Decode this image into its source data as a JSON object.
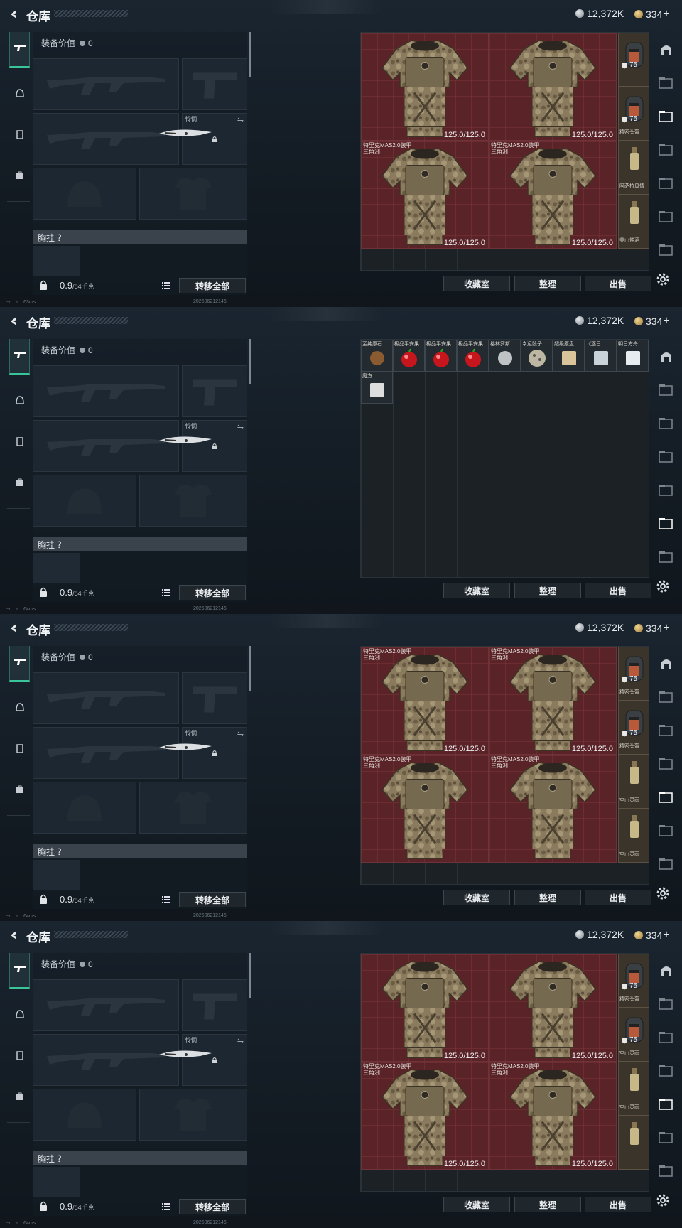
{
  "frames": [
    {
      "title": "仓库",
      "silver": "12,372K",
      "gold": "334",
      "equip_value_label": "装备价值",
      "equip_value": "0",
      "knife_label": "怜悯",
      "chest_label": "胸挂 ？",
      "weight": "0.9",
      "weight_max": "/84千克",
      "transfer_all": "转移全部",
      "btn_vault": "收藏室",
      "btn_sort": "整理",
      "btn_sell": "出售",
      "ping": "63ms",
      "build": "202606212146",
      "grid_items": [
        {
          "name": "",
          "dur": "125.0/125.0"
        },
        {
          "name": "",
          "dur": "125.0/125.0"
        },
        {
          "name": "特里克MAS2.0装甲\n三角洲",
          "dur": "125.0/125.0"
        },
        {
          "name": "特里克MAS2.0装甲\n三角洲",
          "dur": "125.0/125.0"
        }
      ],
      "side_items": [
        {
          "name": "",
          "stat": "75"
        },
        {
          "name": "精密头盔",
          "stat": "75"
        },
        {
          "name": "阿萨拉风情",
          "stat": ""
        },
        {
          "name": "美山佛酒",
          "stat": ""
        }
      ]
    },
    {
      "title": "仓库",
      "silver": "12,372K",
      "gold": "334",
      "equip_value_label": "装备价值",
      "equip_value": "0",
      "knife_label": "怜悯",
      "chest_label": "胸挂 ？",
      "weight": "0.9",
      "weight_max": "/84千克",
      "transfer_all": "转移全部",
      "btn_vault": "收藏室",
      "btn_sort": "整理",
      "btn_sell": "出售",
      "ping": "64ms",
      "build": "202606212146",
      "small_items": [
        {
          "name": "至纯原石"
        },
        {
          "name": "极品平安果"
        },
        {
          "name": "极品平安果"
        },
        {
          "name": "极品平安果"
        },
        {
          "name": "格林罗斯"
        },
        {
          "name": "幸运骰子"
        },
        {
          "name": "超级原盘"
        },
        {
          "name": "《逐日"
        },
        {
          "name": "明日方舟"
        },
        {
          "name": "魔方"
        }
      ]
    },
    {
      "title": "仓库",
      "silver": "12,372K",
      "gold": "334",
      "equip_value_label": "装备价值",
      "equip_value": "0",
      "knife_label": "怜悯",
      "chest_label": "胸挂 ？",
      "weight": "0.9",
      "weight_max": "/84千克",
      "transfer_all": "转移全部",
      "btn_vault": "收藏室",
      "btn_sort": "整理",
      "btn_sell": "出售",
      "ping": "64ms",
      "build": "202606212146",
      "grid_items": [
        {
          "name": "特里克MAS2.0装甲\n三角洲",
          "dur": "125.0/125.0"
        },
        {
          "name": "特里克MAS2.0装甲\n三角洲",
          "dur": "125.0/125.0"
        },
        {
          "name": "特里克MAS2.0装甲\n三角洲",
          "dur": ""
        },
        {
          "name": "特里克MAS2.0装甲\n三角洲",
          "dur": ""
        }
      ],
      "side_items": [
        {
          "name": "精密头盔",
          "stat": "75"
        },
        {
          "name": "精密头盔",
          "stat": "75"
        },
        {
          "name": "空山灵雨",
          "stat": ""
        },
        {
          "name": "空山灵雨",
          "stat": ""
        }
      ]
    },
    {
      "title": "仓库",
      "silver": "12,372K",
      "gold": "334",
      "equip_value_label": "装备价值",
      "equip_value": "0",
      "knife_label": "怜悯",
      "chest_label": "胸挂 ？",
      "weight": "0.9",
      "weight_max": "/84千克",
      "transfer_all": "转移全部",
      "btn_vault": "收藏室",
      "btn_sort": "整理",
      "btn_sell": "出售",
      "ping": "64ms",
      "build": "202606212146",
      "grid_items": [
        {
          "name": "",
          "dur": "125.0/125.0"
        },
        {
          "name": "",
          "dur": "125.0/125.0"
        },
        {
          "name": "特里克MAS2.0装甲\n三角洲",
          "dur": "125.0/125.0"
        },
        {
          "name": "特里克MAS2.0装甲\n三角洲",
          "dur": "125.0/125.0"
        }
      ],
      "side_items": [
        {
          "name": "精密头盔",
          "stat": "75"
        },
        {
          "name": "空山灵雨",
          "stat": "75"
        },
        {
          "name": "空山灵雨",
          "stat": ""
        },
        {
          "name": "",
          "stat": ""
        }
      ]
    }
  ]
}
